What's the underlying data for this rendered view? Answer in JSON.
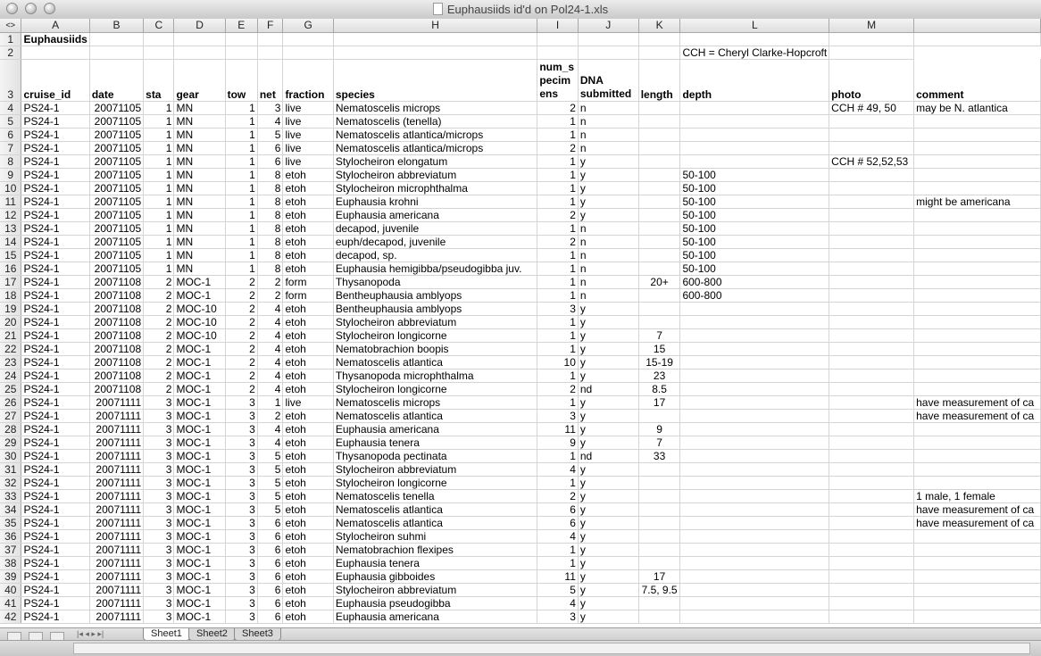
{
  "window": {
    "title": "Euphausiids id'd on Pol24-1.xls"
  },
  "columns": [
    "A",
    "B",
    "C",
    "D",
    "E",
    "F",
    "G",
    "H",
    "I",
    "J",
    "K",
    "L",
    "M"
  ],
  "corner_glyph": "<>",
  "rows": [
    {
      "n": "1",
      "cells": [
        "Euphausiids",
        "",
        "",
        "",
        "",
        "",
        "",
        "",
        "",
        "",
        "",
        "",
        "",
        ""
      ]
    },
    {
      "n": "2",
      "cells": [
        "",
        "",
        "",
        "",
        "",
        "",
        "",
        "",
        "",
        "",
        "",
        "CCH = Cheryl Clarke-Hopcroft",
        ""
      ]
    },
    {
      "n": "3",
      "cells": [
        "cruise_id",
        "date",
        "sta",
        "gear",
        "tow",
        "net",
        "fraction",
        "species",
        "num_specimens",
        "DNA submitted",
        "length",
        "depth",
        "photo",
        "comment"
      ]
    },
    {
      "n": "4",
      "cells": [
        "PS24-1",
        "20071105",
        "1",
        "MN",
        "1",
        "3",
        "live",
        "Nematoscelis microps",
        "2",
        "n",
        "",
        "",
        "CCH # 49, 50",
        "may be N. atlantica"
      ]
    },
    {
      "n": "5",
      "cells": [
        "PS24-1",
        "20071105",
        "1",
        "MN",
        "1",
        "4",
        "live",
        "Nematoscelis (tenella)",
        "1",
        "n",
        "",
        "",
        "",
        ""
      ]
    },
    {
      "n": "6",
      "cells": [
        "PS24-1",
        "20071105",
        "1",
        "MN",
        "1",
        "5",
        "live",
        "Nematoscelis atlantica/microps",
        "1",
        "n",
        "",
        "",
        "",
        ""
      ]
    },
    {
      "n": "7",
      "cells": [
        "PS24-1",
        "20071105",
        "1",
        "MN",
        "1",
        "6",
        "live",
        "Nematoscelis atlantica/microps",
        "2",
        "n",
        "",
        "",
        "",
        ""
      ]
    },
    {
      "n": "8",
      "cells": [
        "PS24-1",
        "20071105",
        "1",
        "MN",
        "1",
        "6",
        "live",
        "Stylocheiron elongatum",
        "1",
        "y",
        "",
        "",
        "CCH # 52,52,53",
        ""
      ]
    },
    {
      "n": "9",
      "cells": [
        "PS24-1",
        "20071105",
        "1",
        "MN",
        "1",
        "8",
        "etoh",
        "Stylocheiron abbreviatum",
        "1",
        "y",
        "",
        "50-100",
        "",
        ""
      ]
    },
    {
      "n": "10",
      "cells": [
        "PS24-1",
        "20071105",
        "1",
        "MN",
        "1",
        "8",
        "etoh",
        "Stylocheiron microphthalma",
        "1",
        "y",
        "",
        "50-100",
        "",
        ""
      ]
    },
    {
      "n": "11",
      "cells": [
        "PS24-1",
        "20071105",
        "1",
        "MN",
        "1",
        "8",
        "etoh",
        "Euphausia krohni",
        "1",
        "y",
        "",
        "50-100",
        "",
        "might be americana"
      ]
    },
    {
      "n": "12",
      "cells": [
        "PS24-1",
        "20071105",
        "1",
        "MN",
        "1",
        "8",
        "etoh",
        "Euphausia americana",
        "2",
        "y",
        "",
        "50-100",
        "",
        ""
      ]
    },
    {
      "n": "13",
      "cells": [
        "PS24-1",
        "20071105",
        "1",
        "MN",
        "1",
        "8",
        "etoh",
        "decapod, juvenile",
        "1",
        "n",
        "",
        "50-100",
        "",
        ""
      ]
    },
    {
      "n": "14",
      "cells": [
        "PS24-1",
        "20071105",
        "1",
        "MN",
        "1",
        "8",
        "etoh",
        "euph/decapod, juvenile",
        "2",
        "n",
        "",
        "50-100",
        "",
        ""
      ]
    },
    {
      "n": "15",
      "cells": [
        "PS24-1",
        "20071105",
        "1",
        "MN",
        "1",
        "8",
        "etoh",
        "decapod, sp.",
        "1",
        "n",
        "",
        "50-100",
        "",
        ""
      ]
    },
    {
      "n": "16",
      "cells": [
        "PS24-1",
        "20071105",
        "1",
        "MN",
        "1",
        "8",
        "etoh",
        "Euphausia hemigibba/pseudogibba juv.",
        "1",
        "n",
        "",
        "50-100",
        "",
        ""
      ]
    },
    {
      "n": "17",
      "cells": [
        "PS24-1",
        "20071108",
        "2",
        "MOC-1",
        "2",
        "2",
        "form",
        "Thysanopoda",
        "1",
        "n",
        "20+",
        "600-800",
        "",
        ""
      ]
    },
    {
      "n": "18",
      "cells": [
        "PS24-1",
        "20071108",
        "2",
        "MOC-1",
        "2",
        "2",
        "form",
        "Bentheuphausia amblyops",
        "1",
        "n",
        "",
        "600-800",
        "",
        ""
      ]
    },
    {
      "n": "19",
      "cells": [
        "PS24-1",
        "20071108",
        "2",
        "MOC-10",
        "2",
        "4",
        "etoh",
        "Bentheuphausia amblyops",
        "3",
        "y",
        "",
        "",
        "",
        ""
      ]
    },
    {
      "n": "20",
      "cells": [
        "PS24-1",
        "20071108",
        "2",
        "MOC-10",
        "2",
        "4",
        "etoh",
        "Stylocheiron abbreviatum",
        "1",
        "y",
        "",
        "",
        "",
        ""
      ]
    },
    {
      "n": "21",
      "cells": [
        "PS24-1",
        "20071108",
        "2",
        "MOC-10",
        "2",
        "4",
        "etoh",
        "Stylocheiron longicorne",
        "1",
        "y",
        "7",
        "",
        "",
        ""
      ]
    },
    {
      "n": "22",
      "cells": [
        "PS24-1",
        "20071108",
        "2",
        "MOC-1",
        "2",
        "4",
        "etoh",
        "Nematobrachion boopis",
        "1",
        "y",
        "15",
        "",
        "",
        ""
      ]
    },
    {
      "n": "23",
      "cells": [
        "PS24-1",
        "20071108",
        "2",
        "MOC-1",
        "2",
        "4",
        "etoh",
        "Nematoscelis atlantica",
        "10",
        "y",
        "15-19",
        "",
        "",
        ""
      ]
    },
    {
      "n": "24",
      "cells": [
        "PS24-1",
        "20071108",
        "2",
        "MOC-1",
        "2",
        "4",
        "etoh",
        "Thysanopoda microphthalma",
        "1",
        "y",
        "23",
        "",
        "",
        ""
      ]
    },
    {
      "n": "25",
      "cells": [
        "PS24-1",
        "20071108",
        "2",
        "MOC-1",
        "2",
        "4",
        "etoh",
        "Stylocheiron longicorne",
        "2",
        "nd",
        "8.5",
        "",
        "",
        ""
      ]
    },
    {
      "n": "26",
      "cells": [
        "PS24-1",
        "20071111",
        "3",
        "MOC-1",
        "3",
        "1",
        "live",
        "Nematoscelis microps",
        "1",
        "y",
        "17",
        "",
        "",
        "have measurement of ca"
      ]
    },
    {
      "n": "27",
      "cells": [
        "PS24-1",
        "20071111",
        "3",
        "MOC-1",
        "3",
        "2",
        "etoh",
        "Nematoscelis atlantica",
        "3",
        "y",
        "",
        "",
        "",
        "have measurement of ca"
      ]
    },
    {
      "n": "28",
      "cells": [
        "PS24-1",
        "20071111",
        "3",
        "MOC-1",
        "3",
        "4",
        "etoh",
        "Euphausia americana",
        "11",
        "y",
        "9",
        "",
        "",
        ""
      ]
    },
    {
      "n": "29",
      "cells": [
        "PS24-1",
        "20071111",
        "3",
        "MOC-1",
        "3",
        "4",
        "etoh",
        "Euphausia tenera",
        "9",
        "y",
        "7",
        "",
        "",
        ""
      ]
    },
    {
      "n": "30",
      "cells": [
        "PS24-1",
        "20071111",
        "3",
        "MOC-1",
        "3",
        "5",
        "etoh",
        "Thysanopoda pectinata",
        "1",
        "nd",
        "33",
        "",
        "",
        ""
      ]
    },
    {
      "n": "31",
      "cells": [
        "PS24-1",
        "20071111",
        "3",
        "MOC-1",
        "3",
        "5",
        "etoh",
        "Stylocheiron abbreviatum",
        "4",
        "y",
        "",
        "",
        "",
        ""
      ]
    },
    {
      "n": "32",
      "cells": [
        "PS24-1",
        "20071111",
        "3",
        "MOC-1",
        "3",
        "5",
        "etoh",
        "Stylocheiron longicorne",
        "1",
        "y",
        "",
        "",
        "",
        ""
      ]
    },
    {
      "n": "33",
      "cells": [
        "PS24-1",
        "20071111",
        "3",
        "MOC-1",
        "3",
        "5",
        "etoh",
        "Nematoscelis tenella",
        "2",
        "y",
        "",
        "",
        "",
        "1 male, 1 female"
      ]
    },
    {
      "n": "34",
      "cells": [
        "PS24-1",
        "20071111",
        "3",
        "MOC-1",
        "3",
        "5",
        "etoh",
        "Nematoscelis atlantica",
        "6",
        "y",
        "",
        "",
        "",
        "have measurement of ca"
      ]
    },
    {
      "n": "35",
      "cells": [
        "PS24-1",
        "20071111",
        "3",
        "MOC-1",
        "3",
        "6",
        "etoh",
        "Nematoscelis atlantica",
        "6",
        "y",
        "",
        "",
        "",
        "have measurement of ca"
      ]
    },
    {
      "n": "36",
      "cells": [
        "PS24-1",
        "20071111",
        "3",
        "MOC-1",
        "3",
        "6",
        "etoh",
        "Stylocheiron suhmi",
        "4",
        "y",
        "",
        "",
        "",
        ""
      ]
    },
    {
      "n": "37",
      "cells": [
        "PS24-1",
        "20071111",
        "3",
        "MOC-1",
        "3",
        "6",
        "etoh",
        "Nematobrachion flexipes",
        "1",
        "y",
        "",
        "",
        "",
        ""
      ]
    },
    {
      "n": "38",
      "cells": [
        "PS24-1",
        "20071111",
        "3",
        "MOC-1",
        "3",
        "6",
        "etoh",
        "Euphausia tenera",
        "1",
        "y",
        "",
        "",
        "",
        ""
      ]
    },
    {
      "n": "39",
      "cells": [
        "PS24-1",
        "20071111",
        "3",
        "MOC-1",
        "3",
        "6",
        "etoh",
        "Euphausia gibboides",
        "11",
        "y",
        "17",
        "",
        "",
        ""
      ]
    },
    {
      "n": "40",
      "cells": [
        "PS24-1",
        "20071111",
        "3",
        "MOC-1",
        "3",
        "6",
        "etoh",
        "Stylocheiron abbreviatum",
        "5",
        "y",
        "7.5, 9.5",
        "",
        "",
        ""
      ]
    },
    {
      "n": "41",
      "cells": [
        "PS24-1",
        "20071111",
        "3",
        "MOC-1",
        "3",
        "6",
        "etoh",
        "Euphausia pseudogibba",
        "4",
        "y",
        "",
        "",
        "",
        ""
      ]
    },
    {
      "n": "42",
      "cells": [
        "PS24-1",
        "20071111",
        "3",
        "MOC-1",
        "3",
        "6",
        "etoh",
        "Euphausia americana",
        "3",
        "y",
        "",
        "",
        "",
        ""
      ]
    }
  ],
  "header_row_lines": {
    "num_specimens": [
      "num_s",
      "pecim",
      "ens"
    ],
    "dna": [
      "DNA",
      "submitted"
    ]
  },
  "sheets": [
    "Sheet1",
    "Sheet2",
    "Sheet3"
  ],
  "active_sheet": "Sheet1",
  "nav_glyphs": "|◂ ◂ ▸ ▸|"
}
